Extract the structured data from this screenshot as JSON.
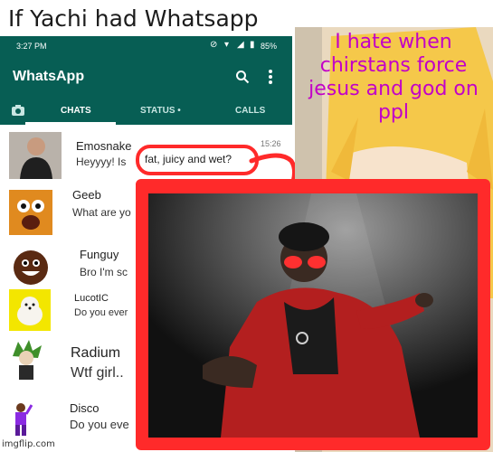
{
  "meme": {
    "title": "If Yachi had Whatsapp",
    "quote": "I hate when chirstans force jesus and god on ppl",
    "watermark": "imgflip.com"
  },
  "status_bar": {
    "time": "3:27 PM",
    "battery": "85%"
  },
  "app_bar": {
    "title": "WhatsApp"
  },
  "tabs": [
    {
      "label": "CHATS"
    },
    {
      "label": "STATUS •"
    },
    {
      "label": "CALLS"
    }
  ],
  "chats": [
    {
      "name": "Emosnake",
      "preview": "Heyyyy! Is",
      "time": "15:26"
    },
    {
      "name": "Geeb",
      "preview": "What are yo"
    },
    {
      "name": "Funguy",
      "preview": "Bro I'm sc"
    },
    {
      "name": "LucotIC",
      "preview": "Do you ever"
    },
    {
      "name": "Radium",
      "preview": "Wtf girl.."
    },
    {
      "name": "Disco",
      "preview": "Do you eve"
    }
  ],
  "highlight_bubble": "fat, juicy and wet?",
  "colors": {
    "whatsapp_green": "#075e54",
    "quote_magenta": "#c200c8",
    "frame_red": "#ff2a2a"
  }
}
